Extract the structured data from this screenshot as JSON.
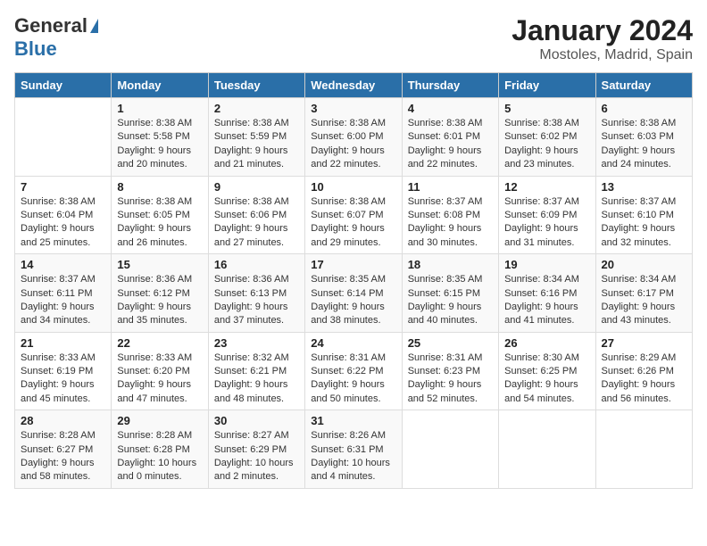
{
  "header": {
    "logo_general": "General",
    "logo_blue": "Blue",
    "title": "January 2024",
    "subtitle": "Mostoles, Madrid, Spain"
  },
  "days_of_week": [
    "Sunday",
    "Monday",
    "Tuesday",
    "Wednesday",
    "Thursday",
    "Friday",
    "Saturday"
  ],
  "weeks": [
    [
      {
        "day": "",
        "info": ""
      },
      {
        "day": "1",
        "info": "Sunrise: 8:38 AM\nSunset: 5:58 PM\nDaylight: 9 hours\nand 20 minutes."
      },
      {
        "day": "2",
        "info": "Sunrise: 8:38 AM\nSunset: 5:59 PM\nDaylight: 9 hours\nand 21 minutes."
      },
      {
        "day": "3",
        "info": "Sunrise: 8:38 AM\nSunset: 6:00 PM\nDaylight: 9 hours\nand 22 minutes."
      },
      {
        "day": "4",
        "info": "Sunrise: 8:38 AM\nSunset: 6:01 PM\nDaylight: 9 hours\nand 22 minutes."
      },
      {
        "day": "5",
        "info": "Sunrise: 8:38 AM\nSunset: 6:02 PM\nDaylight: 9 hours\nand 23 minutes."
      },
      {
        "day": "6",
        "info": "Sunrise: 8:38 AM\nSunset: 6:03 PM\nDaylight: 9 hours\nand 24 minutes."
      }
    ],
    [
      {
        "day": "7",
        "info": "Sunrise: 8:38 AM\nSunset: 6:04 PM\nDaylight: 9 hours\nand 25 minutes."
      },
      {
        "day": "8",
        "info": "Sunrise: 8:38 AM\nSunset: 6:05 PM\nDaylight: 9 hours\nand 26 minutes."
      },
      {
        "day": "9",
        "info": "Sunrise: 8:38 AM\nSunset: 6:06 PM\nDaylight: 9 hours\nand 27 minutes."
      },
      {
        "day": "10",
        "info": "Sunrise: 8:38 AM\nSunset: 6:07 PM\nDaylight: 9 hours\nand 29 minutes."
      },
      {
        "day": "11",
        "info": "Sunrise: 8:37 AM\nSunset: 6:08 PM\nDaylight: 9 hours\nand 30 minutes."
      },
      {
        "day": "12",
        "info": "Sunrise: 8:37 AM\nSunset: 6:09 PM\nDaylight: 9 hours\nand 31 minutes."
      },
      {
        "day": "13",
        "info": "Sunrise: 8:37 AM\nSunset: 6:10 PM\nDaylight: 9 hours\nand 32 minutes."
      }
    ],
    [
      {
        "day": "14",
        "info": "Sunrise: 8:37 AM\nSunset: 6:11 PM\nDaylight: 9 hours\nand 34 minutes."
      },
      {
        "day": "15",
        "info": "Sunrise: 8:36 AM\nSunset: 6:12 PM\nDaylight: 9 hours\nand 35 minutes."
      },
      {
        "day": "16",
        "info": "Sunrise: 8:36 AM\nSunset: 6:13 PM\nDaylight: 9 hours\nand 37 minutes."
      },
      {
        "day": "17",
        "info": "Sunrise: 8:35 AM\nSunset: 6:14 PM\nDaylight: 9 hours\nand 38 minutes."
      },
      {
        "day": "18",
        "info": "Sunrise: 8:35 AM\nSunset: 6:15 PM\nDaylight: 9 hours\nand 40 minutes."
      },
      {
        "day": "19",
        "info": "Sunrise: 8:34 AM\nSunset: 6:16 PM\nDaylight: 9 hours\nand 41 minutes."
      },
      {
        "day": "20",
        "info": "Sunrise: 8:34 AM\nSunset: 6:17 PM\nDaylight: 9 hours\nand 43 minutes."
      }
    ],
    [
      {
        "day": "21",
        "info": "Sunrise: 8:33 AM\nSunset: 6:19 PM\nDaylight: 9 hours\nand 45 minutes."
      },
      {
        "day": "22",
        "info": "Sunrise: 8:33 AM\nSunset: 6:20 PM\nDaylight: 9 hours\nand 47 minutes."
      },
      {
        "day": "23",
        "info": "Sunrise: 8:32 AM\nSunset: 6:21 PM\nDaylight: 9 hours\nand 48 minutes."
      },
      {
        "day": "24",
        "info": "Sunrise: 8:31 AM\nSunset: 6:22 PM\nDaylight: 9 hours\nand 50 minutes."
      },
      {
        "day": "25",
        "info": "Sunrise: 8:31 AM\nSunset: 6:23 PM\nDaylight: 9 hours\nand 52 minutes."
      },
      {
        "day": "26",
        "info": "Sunrise: 8:30 AM\nSunset: 6:25 PM\nDaylight: 9 hours\nand 54 minutes."
      },
      {
        "day": "27",
        "info": "Sunrise: 8:29 AM\nSunset: 6:26 PM\nDaylight: 9 hours\nand 56 minutes."
      }
    ],
    [
      {
        "day": "28",
        "info": "Sunrise: 8:28 AM\nSunset: 6:27 PM\nDaylight: 9 hours\nand 58 minutes."
      },
      {
        "day": "29",
        "info": "Sunrise: 8:28 AM\nSunset: 6:28 PM\nDaylight: 10 hours\nand 0 minutes."
      },
      {
        "day": "30",
        "info": "Sunrise: 8:27 AM\nSunset: 6:29 PM\nDaylight: 10 hours\nand 2 minutes."
      },
      {
        "day": "31",
        "info": "Sunrise: 8:26 AM\nSunset: 6:31 PM\nDaylight: 10 hours\nand 4 minutes."
      },
      {
        "day": "",
        "info": ""
      },
      {
        "day": "",
        "info": ""
      },
      {
        "day": "",
        "info": ""
      }
    ]
  ]
}
